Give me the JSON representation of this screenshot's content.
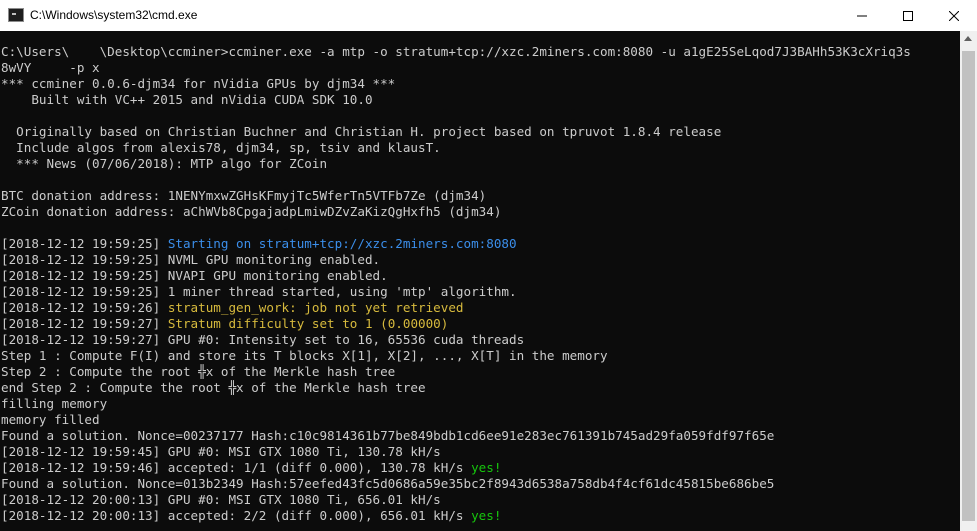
{
  "window": {
    "title": "C:\\Windows\\system32\\cmd.exe",
    "icon": "console-icon",
    "controls": [
      "minimize-icon",
      "maximize-icon",
      "close-icon"
    ]
  },
  "colors": {
    "background": "#0c0c0c",
    "text": "#cccccc",
    "info_blue": "#3b8eea",
    "warn_yellow": "#d7ba3d",
    "ok_green": "#16c60c"
  },
  "console": {
    "lines": [
      {
        "text": "C:\\Users\\    \\Desktop\\ccminer>ccminer.exe -a mtp -o stratum+tcp://xzc.2miners.com:8080 -u a1gE25SeLqod7J3BAHh53K3cXriq3s"
      },
      {
        "text": "8wVY     -p x"
      },
      {
        "text": "*** ccminer 0.0.6-djm34 for nVidia GPUs by djm34 ***"
      },
      {
        "text": "    Built with VC++ 2015 and nVidia CUDA SDK 10.0"
      },
      {
        "text": ""
      },
      {
        "text": "  Originally based on Christian Buchner and Christian H. project based on tpruvot 1.8.4 release"
      },
      {
        "text": "  Include algos from alexis78, djm34, sp, tsiv and klausT."
      },
      {
        "text": "  *** News (07/06/2018): MTP algo for ZCoin"
      },
      {
        "text": ""
      },
      {
        "text": "BTC donation address: 1NENYmxwZGHsKFmyjTc5WferTn5VTFb7Ze (djm34)"
      },
      {
        "text": "ZCoin donation address: aChWVb8CpgajadpLmiwDZvZaKizQgHxfh5 (djm34)"
      },
      {
        "text": ""
      },
      {
        "prefix": "[2018-12-12 19:59:25] ",
        "text": "Starting on stratum+tcp://xzc.2miners.com:8080",
        "color": "blue"
      },
      {
        "text": "[2018-12-12 19:59:25] NVML GPU monitoring enabled."
      },
      {
        "text": "[2018-12-12 19:59:25] NVAPI GPU monitoring enabled."
      },
      {
        "text": "[2018-12-12 19:59:25] 1 miner thread started, using 'mtp' algorithm."
      },
      {
        "prefix": "[2018-12-12 19:59:26] ",
        "text": "stratum_gen_work: job not yet retrieved",
        "color": "yellow"
      },
      {
        "prefix": "[2018-12-12 19:59:27] ",
        "text": "Stratum difficulty set to 1 (0.00000)",
        "color": "yellow"
      },
      {
        "text": "[2018-12-12 19:59:27] GPU #0: Intensity set to 16, 65536 cuda threads"
      },
      {
        "text": "Step 1 : Compute F(I) and store its T blocks X[1], X[2], ..., X[T] in the memory"
      },
      {
        "text": "Step 2 : Compute the root ╬x of the Merkle hash tree"
      },
      {
        "text": "end Step 2 : Compute the root ╬x of the Merkle hash tree"
      },
      {
        "text": "filling memory"
      },
      {
        "text": "memory filled"
      },
      {
        "text": "Found a solution. Nonce=00237177 Hash:c10c9814361b77be849bdb1cd6ee91e283ec761391b745ad29fa059fdf97f65e"
      },
      {
        "text": "[2018-12-12 19:59:45] GPU #0: MSI GTX 1080 Ti, 130.78 kH/s"
      },
      {
        "text": "[2018-12-12 19:59:46] accepted: 1/1 (diff 0.000), 130.78 kH/s ",
        "suffix": "yes!",
        "suffix_color": "green"
      },
      {
        "text": "Found a solution. Nonce=013b2349 Hash:57eefed43fc5d0686a59e35bc2f8943d6538a758db4f4cf61dc45815be686be5"
      },
      {
        "text": "[2018-12-12 20:00:13] GPU #0: MSI GTX 1080 Ti, 656.01 kH/s"
      },
      {
        "text": "[2018-12-12 20:00:13] accepted: 2/2 (diff 0.000), 656.01 kH/s ",
        "suffix": "yes!",
        "suffix_color": "green"
      }
    ]
  }
}
